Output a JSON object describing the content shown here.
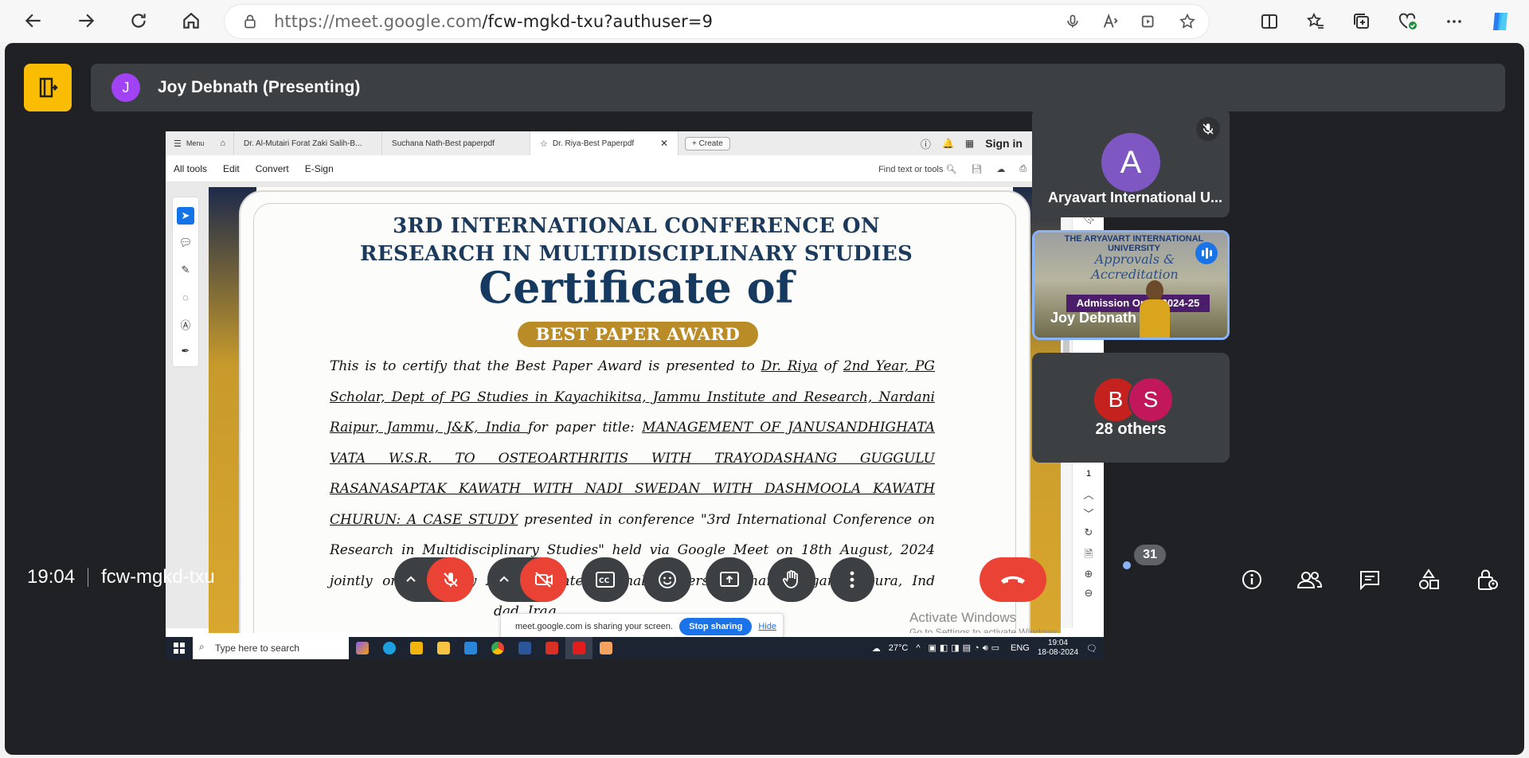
{
  "browser": {
    "url_host": "https://meet.google.com",
    "url_path": "/fcw-mgkd-txu?authuser=9"
  },
  "meet": {
    "presenter_initial": "J",
    "presenter_label": "Joy Debnath (Presenting)",
    "time": "19:04",
    "meeting_code": "fcw-mgkd-txu",
    "participant_count": "31"
  },
  "acrobat": {
    "menu_label": "Menu",
    "tabs": [
      {
        "label": "Dr. Al-Mutairi Forat Zaki Salih-B..."
      },
      {
        "label": "Suchana Nath-Best paperpdf"
      },
      {
        "label": "Dr. Riya-Best Paperpdf"
      }
    ],
    "create_label": "Create",
    "sign_in": "Sign in",
    "toolbar": [
      "All tools",
      "Edit",
      "Convert",
      "E-Sign"
    ],
    "find_label": "Find text or tools",
    "page_current": "1",
    "page_total": "1"
  },
  "certificate": {
    "line1": "3RD INTERNATIONAL CONFERENCE ON",
    "line2": "RESEARCH IN MULTIDISCIPLINARY STUDIES",
    "title": "Certificate of",
    "award": "BEST PAPER AWARD",
    "body_intro": "This is to certify that the Best Paper Award is presented to ",
    "recipient": "Dr. Riya",
    "of": " of ",
    "affiliation": "2nd Year, PG Scholar, Dept of PG Studies in Kayachikitsa, Jammu Institute and Research, Nardani Raipur, Jammu, J&K, India ",
    "paper_intro": " for paper title: ",
    "paper_title": "MANAGEMENT OF JANUSANDHIGHATA VATA W.S.R. TO OSTEOARTHRITIS WITH TRAYODASHANG GUGGULU RASANASAPTAK KAWATH WITH NADI SWEDAN WITH DASHMOOLA KAWATH CHURUN: A CASE STUDY",
    "body_rest": " presented in conference \"3rd International Conference on Research in Multidisciplinary Studies\" held via Google Meet on 18th August, 2024 jointly organized by Aryavart International University, Dharmanagar, Tripura, Ind",
    "body_tail": "dad, Iraq."
  },
  "windows_overlay": {
    "activate_title": "Activate Windows",
    "activate_sub": "Go to Settings to activate Windows."
  },
  "share_bar": {
    "message": "meet.google.com is sharing your screen.",
    "stop": "Stop sharing",
    "hide": "Hide"
  },
  "taskbar": {
    "search_placeholder": "Type here to search",
    "weather": "27°C",
    "lang": "ENG",
    "clock_time": "19:04",
    "clock_date": "18-08-2024"
  },
  "tiles": {
    "tile1_initial": "A",
    "tile1_name": "Aryavart International U...",
    "tile2_banner": "THE ARYAVART INTERNATIONAL UNIVERSITY",
    "tile2_sub": "Approvals & Accreditation",
    "tile2_board": "Admission Open 2024-25",
    "tile2_name": "Joy Debnath",
    "tile3_initial_b": "B",
    "tile3_initial_s": "S",
    "tile3_label": "28 others"
  },
  "colors": {
    "meet_bg": "#202124",
    "tile_bg": "#3c4043",
    "danger": "#ea4335",
    "accent": "#1a73e8",
    "exit_yellow": "#fbbc04"
  }
}
